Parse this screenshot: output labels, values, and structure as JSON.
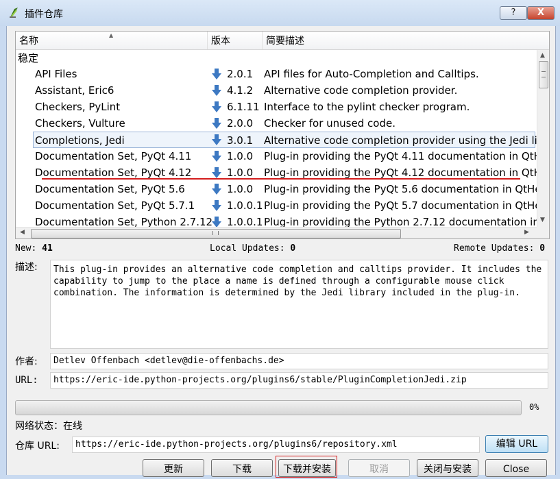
{
  "window": {
    "title": "插件仓库",
    "help_label": "?",
    "close_label": "X"
  },
  "tree": {
    "columns": [
      "名称",
      "版本",
      "简要描述"
    ],
    "group": "稳定",
    "rows": [
      {
        "name": "API Files",
        "version": "2.0.1",
        "desc": "API files for Auto-Completion and Calltips."
      },
      {
        "name": "Assistant, Eric6",
        "version": "4.1.2",
        "desc": "Alternative code completion provider."
      },
      {
        "name": "Checkers, PyLint",
        "version": "6.1.11",
        "desc": "Interface to the pylint checker program."
      },
      {
        "name": "Checkers, Vulture",
        "version": "2.0.0",
        "desc": "Checker for unused code."
      },
      {
        "name": "Completions, Jedi",
        "version": "3.0.1",
        "desc": "Alternative code completion provider using the Jedi li"
      },
      {
        "name": "Documentation Set, PyQt 4.11",
        "version": "1.0.0",
        "desc": "Plug-in providing the PyQt 4.11 documentation in QtH"
      },
      {
        "name": "Documentation Set, PyQt 4.12",
        "version": "1.0.0",
        "desc": "Plug-in providing the PyQt 4.12 documentation in QtH"
      },
      {
        "name": "Documentation Set, PyQt 5.6",
        "version": "1.0.0",
        "desc": "Plug-in providing the PyQt 5.6 documentation in QtHe"
      },
      {
        "name": "Documentation Set, PyQt 5.7.1",
        "version": "1.0.0.1",
        "desc": "Plug-in providing the PyQt 5.7 documentation in QtHe"
      },
      {
        "name": "Documentation Set, Python 2.7.12",
        "version": "1.0.0.1",
        "desc": "Plug-in providing the Python 2.7.12 documentation in"
      }
    ],
    "selected_index": 4
  },
  "status": {
    "new_label": "New:",
    "new_count": "41",
    "local_label": "Local Updates:",
    "local_count": "0",
    "remote_label": "Remote Updates:",
    "remote_count": "0"
  },
  "details": {
    "desc_label": "描述:",
    "description": "This plug-in provides an alternative code completion and calltips provider. It includes the capability to jump to the place a name is defined through a configurable mouse click combination. The information is determined by the Jedi library included in the plug-in.",
    "author_label": "作者:",
    "author": "Detlev Offenbach <detlev@die-offenbachs.de>",
    "url_label": "URL:",
    "url": "https://eric-ide.python-projects.org/plugins6/stable/PluginCompletionJedi.zip"
  },
  "progress": {
    "value": 0,
    "label": "0%"
  },
  "network": {
    "text": "网络状态：在线"
  },
  "repository": {
    "label": "仓库 URL:",
    "url": "https://eric-ide.python-projects.org/plugins6/repository.xml",
    "edit_label": "编辑 URL"
  },
  "buttons": {
    "refresh": "更新",
    "download": "下载",
    "download_install": "下载并安装",
    "cancel": "取消",
    "close_install": "关闭与安装",
    "close": "Close"
  },
  "colors": {
    "accent": "#3c7fb1",
    "annotation": "#d41c1c",
    "arrow_icon": "#3d79c2"
  }
}
